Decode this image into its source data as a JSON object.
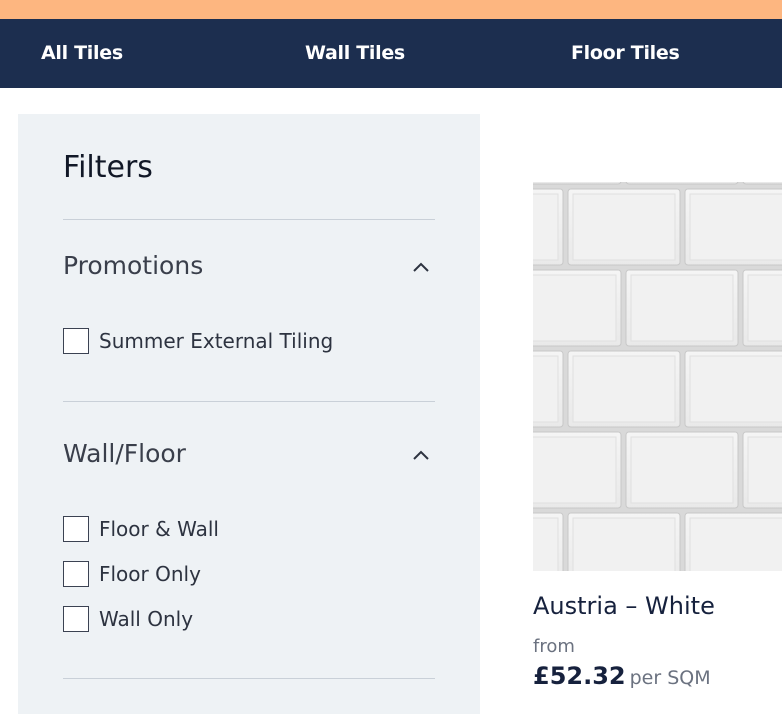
{
  "nav": {
    "items": [
      {
        "label": "All Tiles"
      },
      {
        "label": "Wall Tiles"
      },
      {
        "label": "Floor Tiles"
      }
    ]
  },
  "filters": {
    "title": "Filters",
    "groups": [
      {
        "title": "Promotions",
        "options": [
          {
            "label": "Summer External Tiling",
            "checked": false
          }
        ]
      },
      {
        "title": "Wall/Floor",
        "options": [
          {
            "label": "Floor & Wall",
            "checked": false
          },
          {
            "label": "Floor Only",
            "checked": false
          },
          {
            "label": "Wall Only",
            "checked": false
          }
        ]
      }
    ]
  },
  "product": {
    "name": "Austria – White",
    "from_label": "from",
    "price": "£52.32",
    "unit": "per SQM"
  },
  "colors": {
    "promo_strip": "#fdb680",
    "nav_bg": "#1c2e4f",
    "panel_bg": "#eef2f5",
    "text_dark": "#16213d"
  },
  "icons": {
    "group_toggle": "chevron-up-icon"
  }
}
